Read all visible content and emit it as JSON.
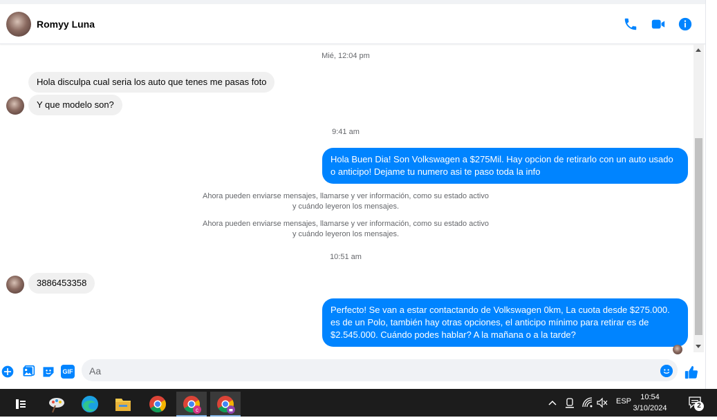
{
  "header": {
    "contact_name": "Romyy Luna",
    "actions": [
      {
        "icon": "phone-icon",
        "label": "call"
      },
      {
        "icon": "video-icon",
        "label": "video call"
      },
      {
        "icon": "info-icon",
        "label": "info"
      }
    ]
  },
  "messages": {
    "timestamp_1": "Mié, 12:04 pm",
    "in_1": "Hola disculpa cual seria los auto que tenes me pasas foto",
    "in_2": "Y que modelo son?",
    "timestamp_2": "9:41 am",
    "out_1": "Hola Buen Dia! Son Volkswagen a $275Mil. Hay opcion de retirarlo con un auto usado o anticipo! Dejame tu numero asi te paso toda la info",
    "sys_1_line1": "Ahora pueden enviarse mensajes, llamarse y ver información, como su estado activo",
    "sys_1_line2": "y cuándo leyeron los mensajes.",
    "sys_2_line1": "Ahora pueden enviarse mensajes, llamarse y ver información, como su estado activo",
    "sys_2_line2": "y cuándo leyeron los mensajes.",
    "timestamp_3": "10:51 am",
    "in_3": "3886453358",
    "out_2": "Perfecto!  Se van a estar contactando de Volkswagen 0km, La cuota desde $275.000. es de un Polo, también hay otras opciones, el anticipo mínimo para retirar es de $2.545.000. Cuándo podes hablar? A la mañana o a la tarde?"
  },
  "composer": {
    "placeholder": "Aa",
    "icons": [
      "plus-icon",
      "photo-icon",
      "sticker-icon",
      "gif-icon",
      "emoji-icon",
      "like-icon"
    ],
    "gif_label": "GIF"
  },
  "taskbar": {
    "language": "ESP",
    "time": "10:54",
    "date": "3/10/2024",
    "notification_count": "2",
    "apps": [
      "task-view",
      "paint",
      "edge",
      "file-explorer",
      "chrome",
      "chrome-profile-c",
      "chrome-profile-incognito"
    ]
  },
  "colors": {
    "brand_blue": "#0084ff",
    "incoming_bubble": "#f0f0f0",
    "taskbar": "#1c1c1c"
  }
}
